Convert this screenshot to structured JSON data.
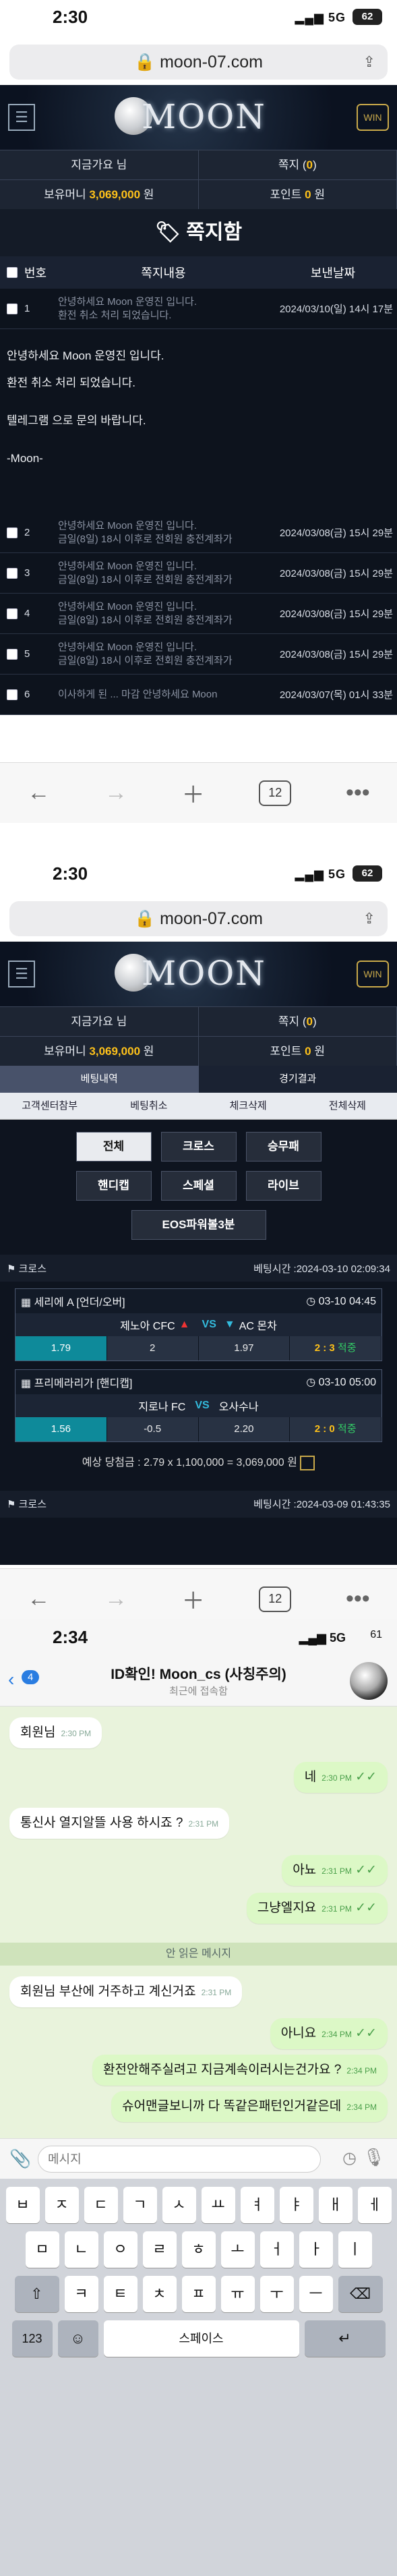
{
  "shot1": {
    "status": {
      "time": "2:30",
      "signal": "5G",
      "battery": "62"
    },
    "url": "moon-07.com",
    "logo": "MOON",
    "user": {
      "greeting": "지금가요 님",
      "note_label": "쪽지 (",
      "note_count": "0",
      "note_close": ")",
      "money_label": "보유머니 ",
      "money": "3,069,000",
      "money_unit": " 원",
      "points_label": "포인트 ",
      "points": "0",
      "points_unit": " 원"
    },
    "page_title": "쪽지함",
    "columns": {
      "num": "번호",
      "content": "쪽지내용",
      "date": "보낸날짜"
    },
    "rows": [
      {
        "num": "1",
        "subject": "안녕하세요 Moon 운영진 입니다.",
        "preview": "환전 취소 처리 되었습니다.",
        "date": "2024/03/10(일) 14시 17분"
      },
      {
        "num": "2",
        "subject": "금일(8일) 18시 이후로 전회원 충전계좌가",
        "preview": "안녕하세요 Moon 운영진 입니다.",
        "date": "2024/03/08(금) 15시 29분"
      },
      {
        "num": "3",
        "subject": "금일(8일) 18시 이후로 전회원 충전계좌가",
        "preview": "안녕하세요 Moon 운영진 입니다.",
        "date": "2024/03/08(금) 15시 29분"
      },
      {
        "num": "4",
        "subject": "금일(8일) 18시 이후로 전회원 충전계좌가",
        "preview": "안녕하세요 Moon 운영진 입니다.",
        "date": "2024/03/08(금) 15시 29분"
      },
      {
        "num": "5",
        "subject": "금일(8일) 18시 이후로 전회원 충전계좌가",
        "preview": "안녕하세요 Moon 운영진 입니다.",
        "date": "2024/03/08(금) 15시 29분"
      },
      {
        "num": "6",
        "subject": "이사하게 된 ... 마감 안녕하세요 Moon",
        "preview": "",
        "date": "2024/03/07(목) 01시 33분"
      }
    ],
    "open_message": [
      "안녕하세요 Moon 운영진 입니다.",
      "환전 취소 처리 되었습니다.",
      "텔레그램 으로 문의 바랍니다.",
      "-Moon-"
    ],
    "tab_count": "12"
  },
  "shot2": {
    "status": {
      "time": "2:30",
      "signal": "5G",
      "battery": "62"
    },
    "url": "moon-07.com",
    "logo": "MOON",
    "user": {
      "greeting": "지금가요 님",
      "note_label": "쪽지 (",
      "note_count": "0",
      "note_close": ")",
      "money_label": "보유머니 ",
      "money": "3,069,000",
      "money_unit": " 원",
      "points_label": "포인트 ",
      "points": "0",
      "points_unit": " 원"
    },
    "tabs": [
      "베팅내역",
      "경기결과"
    ],
    "subtabs": [
      "고객센터참부",
      "베팅취소",
      "체크삭제",
      "전체삭제"
    ],
    "game_buttons": [
      "전체",
      "크로스",
      "승무패",
      "핸디캡",
      "스페셜",
      "라이브"
    ],
    "eos": "EOS파워볼3분",
    "bet1": {
      "type": "크로스",
      "time": "베팅시간 :2024-03-10 02:09:34",
      "g1": {
        "league": "세리에 A [언더/오버]",
        "kickoff": "03-10 04:45",
        "home": "제노아 CFC",
        "vs": "VS",
        "away": "AC 몬차",
        "o1": "1.79",
        "o2": "2",
        "o3": "1.97",
        "result": "2 : 3",
        "status": "적중"
      },
      "g2": {
        "league": "프리메라리가 [핸디캡]",
        "kickoff": "03-10 05:00",
        "home": "지로나 FC",
        "vs": "VS",
        "away": "오사수나",
        "o1": "1.56",
        "o2": "-0.5",
        "o3": "2.20",
        "result": "2 : 0",
        "status": "적중"
      },
      "expected": "예상 당첨금 : 2.79 x 1,100,000 = 3,069,000 원"
    },
    "bet2": {
      "type": "크로스",
      "time": "베팅시간 :2024-03-09 01:43:35"
    },
    "tab_count": "12"
  },
  "shot3": {
    "status": {
      "time": "2:34",
      "signal": "5G",
      "battery": "61"
    },
    "back_count": "4",
    "chat_title": "ID확인! Moon_cs (사칭주의)",
    "chat_sub": "최근에 접속함",
    "messages": [
      {
        "side": "left",
        "text": "회원님",
        "time": "2:30 PM"
      },
      {
        "side": "right",
        "text": "네",
        "time": "2:30 PM"
      },
      {
        "side": "left",
        "text": "통신사 열지알뜰 사용 하시죠 ?",
        "time": "2:31 PM"
      },
      {
        "side": "right",
        "text": "아뇨",
        "time": "2:31 PM"
      },
      {
        "side": "right",
        "text": "그냥엘지요",
        "time": "2:31 PM"
      },
      {
        "side": "left",
        "text": "회원님 부산에 거주하고 계신거죠",
        "time": "2:31 PM"
      },
      {
        "side": "right",
        "text": "아니요",
        "time": "2:34 PM"
      },
      {
        "side": "right",
        "text": "환전안해주실려고 지금계속이러시는건가요 ?",
        "time": "2:34 PM"
      },
      {
        "side": "right",
        "text": "슈어맨글보니까 다 똑같은패턴인거같은데",
        "time": "2:34 PM"
      }
    ],
    "unread_label": "안 읽은 메시지",
    "input_placeholder": "메시지",
    "kb_row1": [
      "ㅂ",
      "ㅈ",
      "ㄷ",
      "ㄱ",
      "ㅅ",
      "ㅛ",
      "ㅕ",
      "ㅑ",
      "ㅐ",
      "ㅔ"
    ],
    "kb_row2": [
      "ㅁ",
      "ㄴ",
      "ㅇ",
      "ㄹ",
      "ㅎ",
      "ㅗ",
      "ㅓ",
      "ㅏ",
      "ㅣ"
    ],
    "kb_row3": [
      "ㅋ",
      "ㅌ",
      "ㅊ",
      "ㅍ",
      "ㅠ",
      "ㅜ",
      "ㅡ"
    ],
    "kb_num": "123",
    "kb_space": "스페이스"
  }
}
